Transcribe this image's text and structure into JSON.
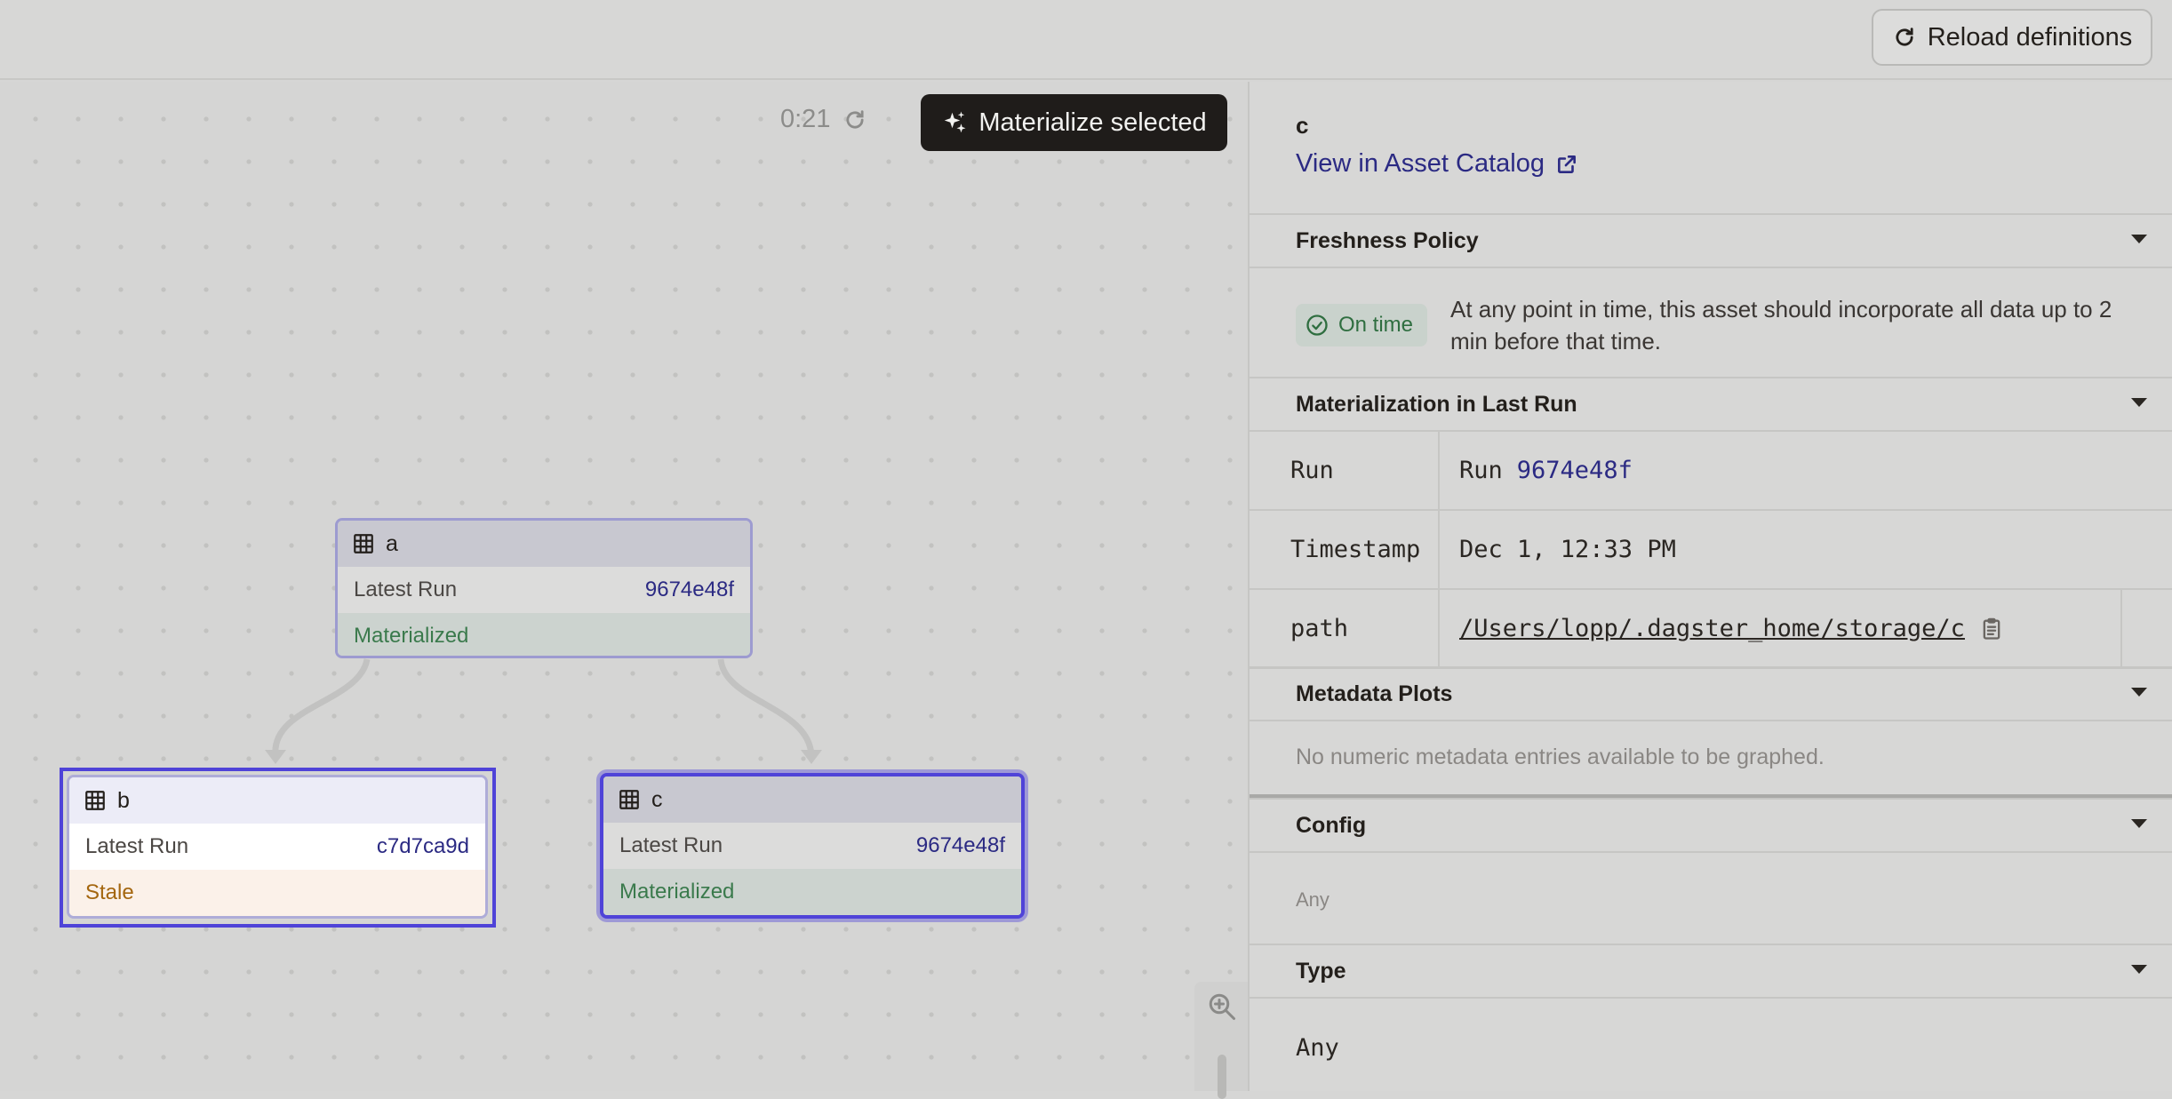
{
  "topbar": {
    "reload_label": "Reload definitions",
    "reload_icon": "refresh-icon"
  },
  "graph": {
    "timer": "0:21",
    "materialize_label": "Materialize selected",
    "nodes": {
      "a": {
        "name": "a",
        "row_label": "Latest Run",
        "run_id": "9674e48f",
        "status": "Materialized"
      },
      "b": {
        "name": "b",
        "row_label": "Latest Run",
        "run_id": "c7d7ca9d",
        "status": "Stale"
      },
      "c": {
        "name": "c",
        "row_label": "Latest Run",
        "run_id": "9674e48f",
        "status": "Materialized"
      }
    },
    "colors": {
      "selection": "#4f43d8",
      "materialized": "#3a7a4c",
      "stale": "#a4660e",
      "run_link": "#2b2a83"
    }
  },
  "panel": {
    "asset_name": "c",
    "catalog_link": "View in Asset Catalog",
    "sections": {
      "freshness": "Freshness Policy",
      "materialization": "Materialization in Last Run",
      "metadata_plots": "Metadata Plots",
      "config": "Config",
      "type": "Type"
    },
    "freshness": {
      "badge": "On time",
      "description": "At any point in time, this asset should incorporate all data up to 2 min before that time."
    },
    "materialization_rows": [
      {
        "key": "Run",
        "prefix": "Run",
        "value": "9674e48f"
      },
      {
        "key": "Timestamp",
        "value": "Dec 1, 12:33 PM"
      },
      {
        "key": "path",
        "value": "/Users/lopp/.dagster_home/storage/c"
      }
    ],
    "metadata_plots_empty": "No numeric metadata entries available to be graphed.",
    "config_value": "Any",
    "type_value": "Any"
  }
}
